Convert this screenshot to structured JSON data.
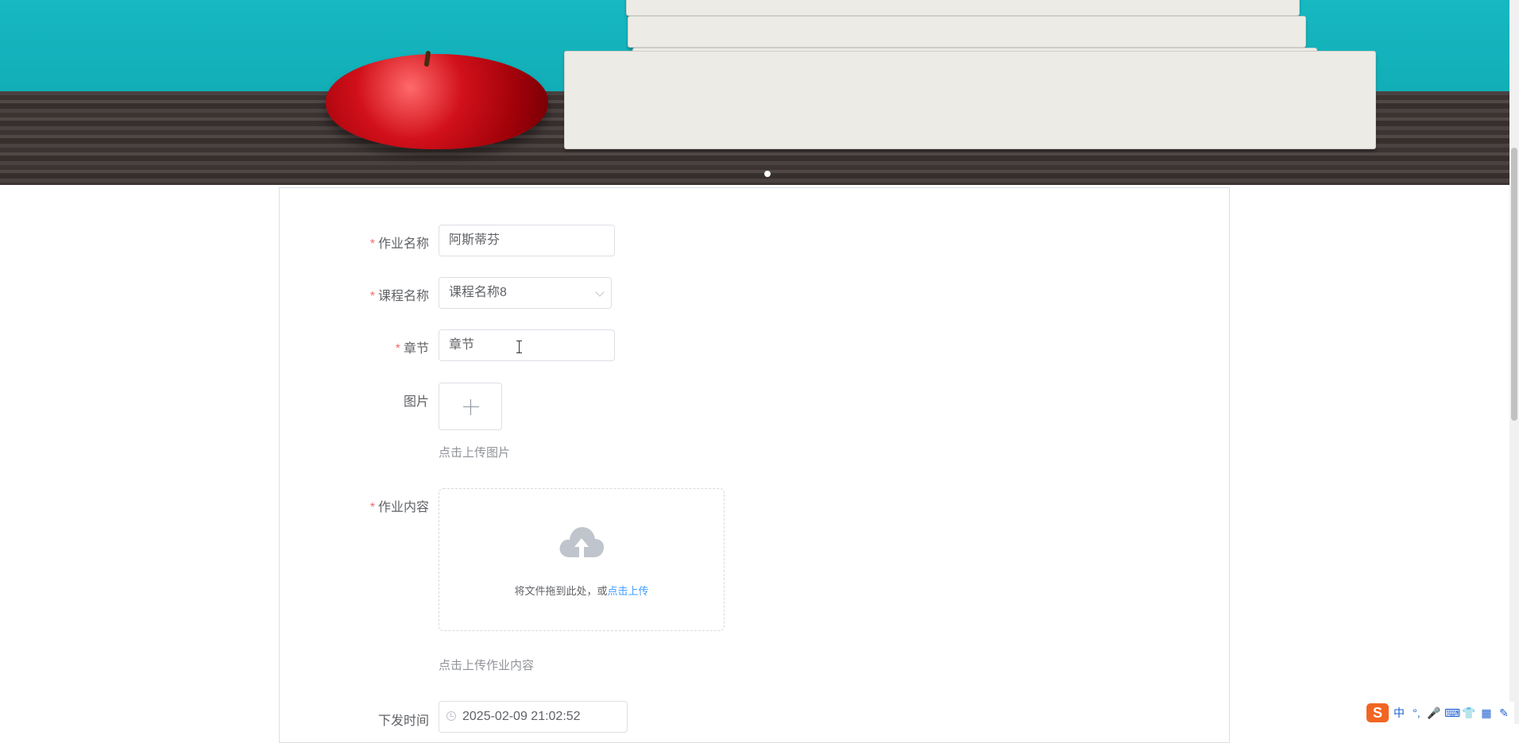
{
  "form": {
    "homework_name": {
      "label": "作业名称",
      "value": "阿斯蒂芬",
      "required": true
    },
    "course_name": {
      "label": "课程名称",
      "value": "课程名称8",
      "required": true
    },
    "chapter": {
      "label": "章节",
      "value": "章节",
      "required": true
    },
    "image": {
      "label": "图片",
      "tip": "点击上传图片"
    },
    "content": {
      "label": "作业内容",
      "required": true,
      "drop_text": "将文件拖到此处，或",
      "click_text": "点击上传",
      "tip": "点击上传作业内容"
    },
    "publish_time": {
      "label": "下发时间",
      "value": "2025-02-09 21:02:52"
    }
  },
  "tray": {
    "logo": "S",
    "ime": "中",
    "punct": "°,",
    "mic": "🎤",
    "keyboard": "⌨",
    "skin": "👕",
    "apps": "▦",
    "extra": "✎"
  },
  "colors": {
    "required_star": "#f56c6c",
    "link": "#409eff",
    "banner_bg": "#16b8c1"
  }
}
